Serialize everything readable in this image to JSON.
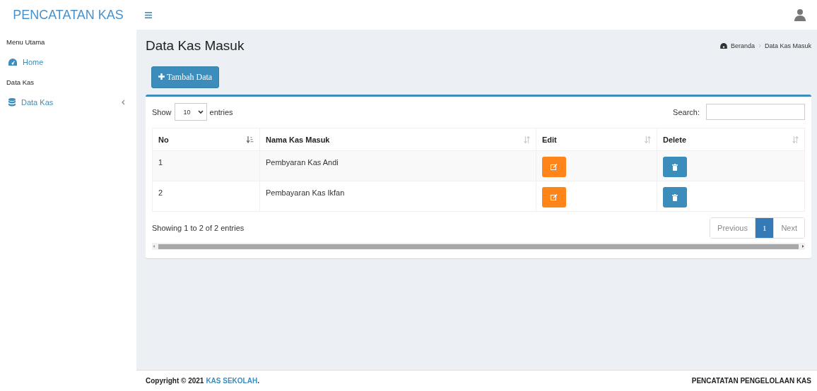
{
  "brand": "PENCATATAN KAS",
  "sidebar": {
    "items": [
      {
        "kind": "header",
        "label": "Menu Utama"
      },
      {
        "kind": "link",
        "label": "Home"
      },
      {
        "kind": "header",
        "label": "Data Kas"
      },
      {
        "kind": "link",
        "label": "Data Kas",
        "expandable": true
      }
    ]
  },
  "page": {
    "title": "Data Kas Masuk",
    "breadcrumb": [
      "Beranda",
      "Data Kas Masuk"
    ]
  },
  "add_button": "Tambah Data",
  "table_controls": {
    "show_label": "Show",
    "page_size": "10",
    "entries_label": "entries",
    "search_label": "Search:"
  },
  "table": {
    "columns": [
      {
        "label": "No",
        "sorted": true
      },
      {
        "label": "Nama Kas Masuk",
        "sorted": false
      },
      {
        "label": "Edit",
        "sorted": false
      },
      {
        "label": "Delete",
        "sorted": false
      }
    ],
    "rows": [
      {
        "no": "1",
        "name": "Pembyaran Kas Andi"
      },
      {
        "no": "2",
        "name": "Pembayaran Kas Ikfan"
      }
    ]
  },
  "info": "Showing 1 to 2 of 2 entries",
  "pagination": [
    {
      "label": "Previous",
      "selected": false
    },
    {
      "label": "1",
      "selected": true
    },
    {
      "label": "Next",
      "selected": false
    }
  ],
  "footer": {
    "copyright": "Copyright © 2021",
    "link": "KAS SEKOLAH",
    "end": ".",
    "right": "PENCATATAN PENGELOLAAN KAS"
  }
}
